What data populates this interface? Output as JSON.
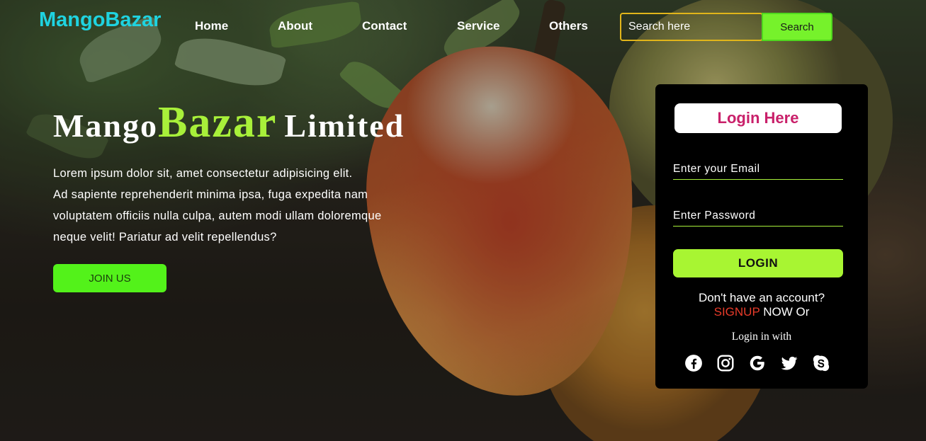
{
  "brand": {
    "logo": "MangoBazar"
  },
  "nav": {
    "items": [
      "Home",
      "About",
      "Contact",
      "Service",
      "Others"
    ],
    "search_placeholder": "Search here",
    "search_button": "Search"
  },
  "hero": {
    "title_part1": "Mango",
    "title_part2": "Bazar",
    "title_part3": "Limited",
    "paragraph_lines": [
      "Lorem ipsum dolor sit, amet consectetur adipisicing elit.",
      "Ad sapiente reprehenderit minima ipsa, fuga expedita nam",
      "voluptatem officiis nulla culpa, autem modi ullam doloremque",
      "neque velit! Pariatur ad velit repellendus?"
    ],
    "join_button": "JOIN US"
  },
  "login_card": {
    "title": "Login Here",
    "email_placeholder": "Enter your Email",
    "password_placeholder": "Enter Password",
    "login_button": "LOGIN",
    "no_account_text": "Don't have an account?",
    "signup_link": "SIGNUP",
    "signup_suffix": " NOW Or",
    "login_with": "Login in with",
    "social_icons": [
      "facebook-icon",
      "instagram-icon",
      "google-icon",
      "twitter-icon",
      "skype-icon"
    ]
  },
  "colors": {
    "logo": "#1fd3e0",
    "accent_green": "#a8f03a",
    "join_green": "#53f21a",
    "search_border": "#e1b51a",
    "card_title": "#c9206a",
    "signup": "#e83b2a"
  }
}
